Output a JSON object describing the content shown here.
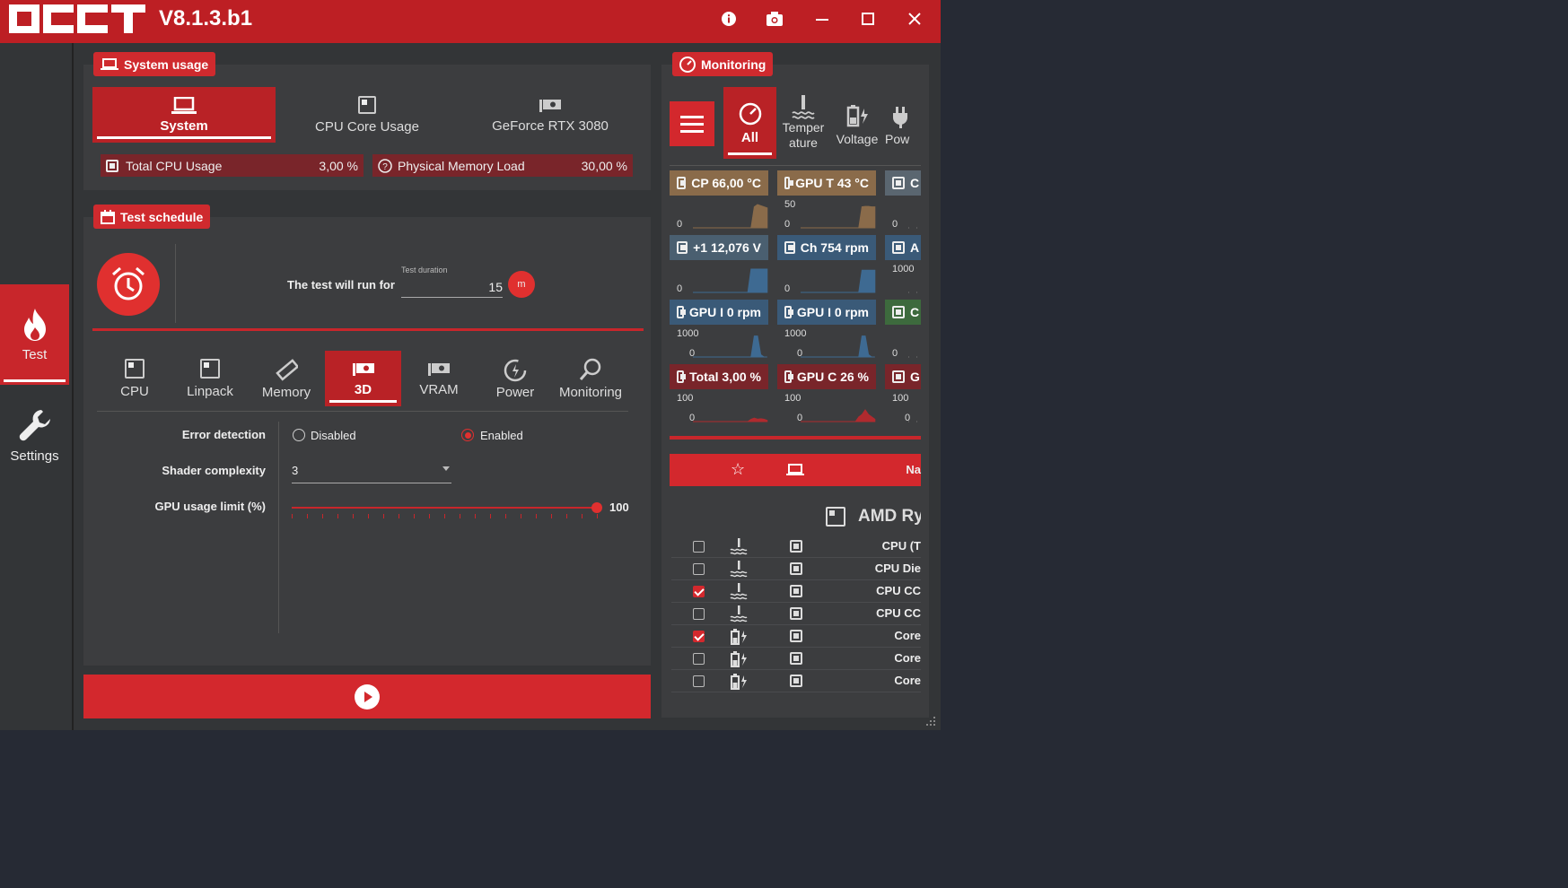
{
  "app": {
    "logo": "OCCT",
    "version": "V8.1.3.b1"
  },
  "sidebar": {
    "items": [
      {
        "label": "Test",
        "icon": "flame-icon"
      },
      {
        "label": "Settings",
        "icon": "wrench-icon"
      }
    ]
  },
  "system_usage": {
    "tag": "System usage",
    "tabs": [
      {
        "label": "System"
      },
      {
        "label": "CPU Core Usage"
      },
      {
        "label": "GeForce RTX 3080"
      }
    ],
    "stats": [
      {
        "label": "Total CPU Usage",
        "value": "3,00 %"
      },
      {
        "label": "Physical Memory Load",
        "value": "30,00 %"
      }
    ]
  },
  "test_schedule": {
    "tag": "Test schedule",
    "run_label": "The test will run for",
    "duration_label": "Test duration",
    "duration_value": "15",
    "unit": "m"
  },
  "test_tabs": [
    {
      "label": "CPU"
    },
    {
      "label": "Linpack"
    },
    {
      "label": "Memory"
    },
    {
      "label": "3D"
    },
    {
      "label": "VRAM"
    },
    {
      "label": "Power"
    },
    {
      "label": "Monitoring"
    }
  ],
  "settings": {
    "error_detection": {
      "label": "Error detection",
      "options": [
        "Disabled",
        "Enabled"
      ],
      "selected": "Enabled"
    },
    "shader": {
      "label": "Shader complexity",
      "value": "3"
    },
    "gpu_limit": {
      "label": "GPU usage limit (%)",
      "value": "100",
      "level": 1.0
    }
  },
  "monitoring": {
    "tag": "Monitoring",
    "filters": [
      {
        "label": "All"
      },
      {
        "label": "Temper ature"
      },
      {
        "label": "Voltage"
      },
      {
        "label": "Pow"
      }
    ],
    "tiles": [
      {
        "title": "CP 66,00 °C",
        "min": "0",
        "max": "",
        "color": "#8a6b4a"
      },
      {
        "title": "GPU T 43 °C",
        "min": "0",
        "max": "50",
        "color": "#8a6b4a"
      },
      {
        "title": "C",
        "min": "0",
        "max": "",
        "color": "#5a6670"
      },
      {
        "title": "+1 12,076 V",
        "min": "0",
        "max": "",
        "color": "#4a5f70"
      },
      {
        "title": "Ch 754 rpm",
        "min": "0",
        "max": "",
        "color": "#3a5a78"
      },
      {
        "title": "A",
        "min": "",
        "max": "1000",
        "color": "#3a5a78"
      },
      {
        "title": "GPU I 0 rpm",
        "min": "0",
        "max": "1000",
        "color": "#3a5a78"
      },
      {
        "title": "GPU I 0 rpm",
        "min": "0",
        "max": "1000",
        "color": "#3a5a78"
      },
      {
        "title": "C",
        "min": "0",
        "max": "",
        "color": "#3d6a3d"
      },
      {
        "title": "Total 3,00 %",
        "min": "0",
        "max": "100",
        "color": "#79252a"
      },
      {
        "title": "GPU C 26 %",
        "min": "0",
        "max": "100",
        "color": "#79252a"
      },
      {
        "title": "G",
        "min": "0",
        "max": "100",
        "color": "#79252a"
      }
    ],
    "list_header": {
      "name_col": "Na"
    },
    "device": "AMD Ry",
    "sensors": [
      {
        "name": "CPU (T",
        "checked": false,
        "type": "temperature"
      },
      {
        "name": "CPU Die",
        "checked": false,
        "type": "temperature"
      },
      {
        "name": "CPU CC",
        "checked": true,
        "type": "temperature"
      },
      {
        "name": "CPU CC",
        "checked": false,
        "type": "temperature"
      },
      {
        "name": "Core",
        "checked": true,
        "type": "voltage"
      },
      {
        "name": "Core",
        "checked": false,
        "type": "voltage"
      },
      {
        "name": "Core",
        "checked": false,
        "type": "voltage"
      }
    ]
  }
}
